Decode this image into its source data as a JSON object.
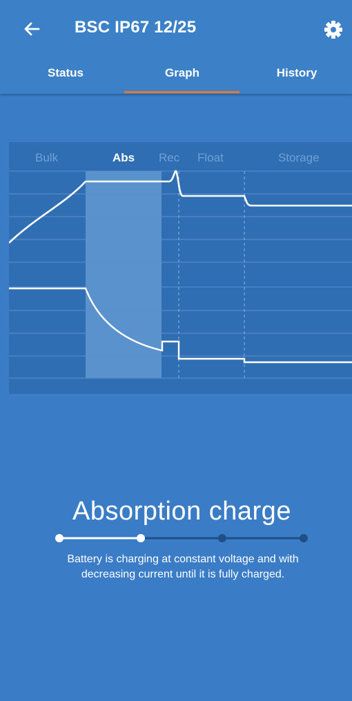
{
  "header": {
    "title": "BSC IP67 12/25",
    "back_icon": "arrow-left-icon",
    "settings_icon": "gear-icon"
  },
  "tabs": [
    {
      "label": "Status",
      "active": false
    },
    {
      "label": "Graph",
      "active": true
    },
    {
      "label": "History",
      "active": false
    }
  ],
  "graph": {
    "phases": [
      {
        "label": "Bulk",
        "active": false
      },
      {
        "label": "Abs",
        "active": true
      },
      {
        "label": "Rec",
        "active": false
      },
      {
        "label": "Float",
        "active": false
      },
      {
        "label": "Storage",
        "active": false
      }
    ]
  },
  "charge_state": {
    "title": "Absorption charge",
    "description_line1": "Battery is charging at constant voltage and with",
    "description_line2": "decreasing current until it is fully charged.",
    "steps_total": 4,
    "current_step": 2
  },
  "colors": {
    "background": "#3a7dc6",
    "graph_background": "#2f6eb3",
    "accent": "#e9762d",
    "stepper_inactive": "#1f4f86"
  }
}
